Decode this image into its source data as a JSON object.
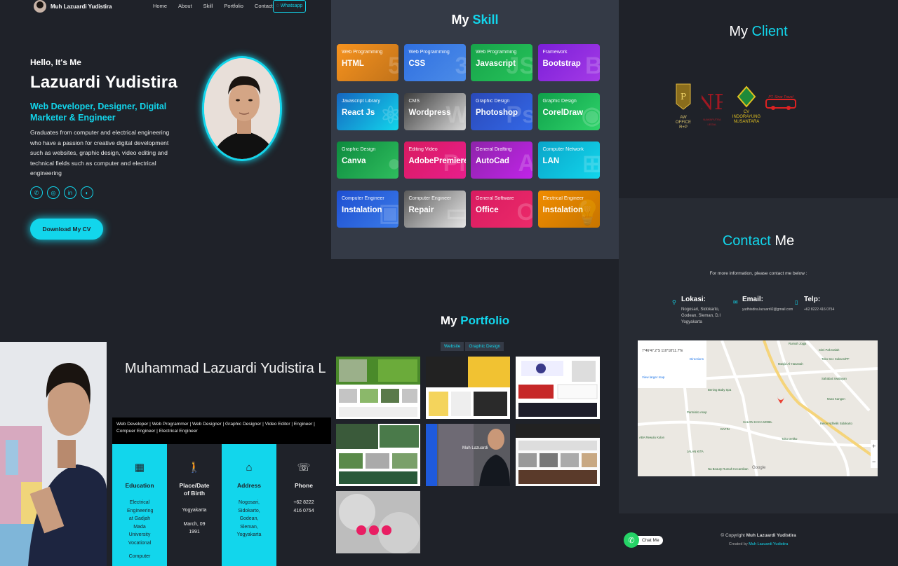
{
  "nav": {
    "brand": "Muh Lazuardi Yudistira",
    "items": [
      "Home",
      "About",
      "Skill",
      "Portfolio",
      "Contact"
    ],
    "whatsapp": "Whatsapp"
  },
  "hero": {
    "hello": "Hello, It's Me",
    "name": "Lazuardi Yudistira",
    "role": "Web Developer, Designer, Digital Marketer & Engineer",
    "description": "Graduates from computer and electrical engineering who have a passion for creative digital development such as websites, graphic design, video editing and technical fields such as computer and electrical engineering",
    "socials": [
      "whatsapp-icon",
      "instagram-icon",
      "linkedin-icon",
      "github-icon"
    ],
    "cv_button": "Download My CV"
  },
  "about": {
    "full_name": "Muhammad Lazuardi Yudistira L",
    "tags": "Web Developer | Web Programmer | Web Designer | Graphic Designer | Video Editor | Engineer | Compuer Engineer | Electrical Engineer",
    "columns": [
      {
        "icon": "building-icon",
        "label": "Education",
        "value": "Electrical Engineering at Gadjah Mada University Vocational",
        "value2": "Computer"
      },
      {
        "icon": "person-icon",
        "label": "Place/Date of Birth",
        "value": "Yogyakarta",
        "value2": "March, 09 1991"
      },
      {
        "icon": "home-icon",
        "label": "Address",
        "value": "Nogosari, Sidokarto, Godean, Sleman, Yogyakarta",
        "value2": ""
      },
      {
        "icon": "phone-icon",
        "label": "Phone",
        "value": "+62 8222 416 0754",
        "value2": ""
      }
    ]
  },
  "skill": {
    "title_a": "My",
    "title_b": "Skill",
    "cards": [
      {
        "cat": "Web Programming",
        "name": "HTML",
        "from": "#f7931e",
        "to": "#c2731a",
        "glyph": "5"
      },
      {
        "cat": "Web Programming",
        "name": "CSS",
        "from": "#2f6fe0",
        "to": "#4c8ce8",
        "glyph": "3"
      },
      {
        "cat": "Web Programming",
        "name": "Javascript",
        "from": "#17a34a",
        "to": "#26c35a",
        "glyph": "JS"
      },
      {
        "cat": "Framework",
        "name": "Bootstrap",
        "from": "#7b1fd8",
        "to": "#a43ae6",
        "glyph": "B"
      },
      {
        "cat": "Javascript Library",
        "name": "React Js",
        "from": "#1565c0",
        "to": "#12d6ec",
        "glyph": "⚛"
      },
      {
        "cat": "CMS",
        "name": "Wordpress",
        "from": "#3d3d3d",
        "to": "#d9d9d9",
        "glyph": "W"
      },
      {
        "cat": "Graphic Design",
        "name": "Photoshop",
        "from": "#2a49b8",
        "to": "#3367e6",
        "glyph": "Ps"
      },
      {
        "cat": "Graphic Design",
        "name": "CorelDraw",
        "from": "#0fa04a",
        "to": "#2fd36a",
        "glyph": "◉"
      },
      {
        "cat": "Graphic Design",
        "name": "Canva",
        "from": "#0d8a3e",
        "to": "#2fbe5e",
        "glyph": "●"
      },
      {
        "cat": "Editing Video",
        "name": "AdobePremiere",
        "from": "#d81b60",
        "to": "#e91e8c",
        "glyph": "Pr"
      },
      {
        "cat": "General Drafting",
        "name": "AutoCad",
        "from": "#8e24aa",
        "to": "#c024e8",
        "glyph": "A"
      },
      {
        "cat": "Computer Network",
        "name": "LAN",
        "from": "#0aa5c9",
        "to": "#12d6ec",
        "glyph": "⊞"
      },
      {
        "cat": "Computer Engineer",
        "name": "Instalation",
        "from": "#1e4fd1",
        "to": "#3a7ae8",
        "glyph": "▣"
      },
      {
        "cat": "Computer Engineer",
        "name": "Repair",
        "from": "#5a5a5a",
        "to": "#e6e6e6",
        "glyph": "▭"
      },
      {
        "cat": "General Software",
        "name": "Office",
        "from": "#d81b60",
        "to": "#ec2a6a",
        "glyph": "O"
      },
      {
        "cat": "Electrical Engineer",
        "name": "Instalation",
        "from": "#f08c00",
        "to": "#c77500",
        "glyph": "💡"
      }
    ]
  },
  "client": {
    "title_a": "My",
    "title_b": "Client",
    "logos": [
      {
        "text": "AW OFFICE R+P",
        "color": "#d9b23a"
      },
      {
        "text": "NAWAPUTRA LEGAL",
        "color": "#b0202a"
      },
      {
        "text": "CV INDORAYUNG NUSANTARA",
        "color": "#e0c020"
      },
      {
        "text": "PT. Sinar Travel",
        "color": "#d22"
      }
    ]
  },
  "contact": {
    "title_a": "Contact",
    "title_b": "Me",
    "subtitle": "For more information, please contact me below :",
    "items": [
      {
        "icon": "location-icon",
        "head": "Lokasi:",
        "text": "Nogosari, Sidokarto, Godean, Sleman, D.I Yogyakarta"
      },
      {
        "icon": "mail-icon",
        "head": "Email:",
        "text": "yudhisdira.lazuardi2@gmail.com"
      },
      {
        "icon": "phone-icon",
        "head": "Telp:",
        "text": "+62 8222 416 0754"
      }
    ],
    "map": {
      "coords": "7°46'47.2\"S 110°18'11.7\"E",
      "address": "Jl. Beringin Jl. Nogosari No.9, Nogosari, Sidokarto, Kec. Godean, Kabupaten Sleman, Daerah Istimewa Yogyakarta 55264",
      "directions": "Directions",
      "larger": "View larger map",
      "labels": [
        "Rumah Jogja",
        "Simi Pak Dalah",
        "Masjid Al-Hasanah",
        "Toko Sec Sukses/PF",
        "Sahabat Swalayan",
        "Bening Baby Spa",
        "Parmisito Asep",
        "Mura Kangen",
        "SALON KACA MOBIL",
        "DAFIN",
        "Kelon Ndhelik Sidokarto",
        "Toko Dekko",
        "JALAN KITA",
        "Na Beauty Rumah Kecantikan",
        "ABA Rewulu Kulon",
        "Google"
      ]
    }
  },
  "portfolio": {
    "title_a": "My",
    "title_b": "Portfolio",
    "filters": [
      "Website",
      "Graphic Design"
    ]
  },
  "footer": {
    "copyright_a": "© Copyright",
    "copyright_b": "Muh Lazuardi Yudistira",
    "created_a": "Created by",
    "created_b": "Muh Lazuardi Yudistira",
    "chat": "Chat Me"
  }
}
